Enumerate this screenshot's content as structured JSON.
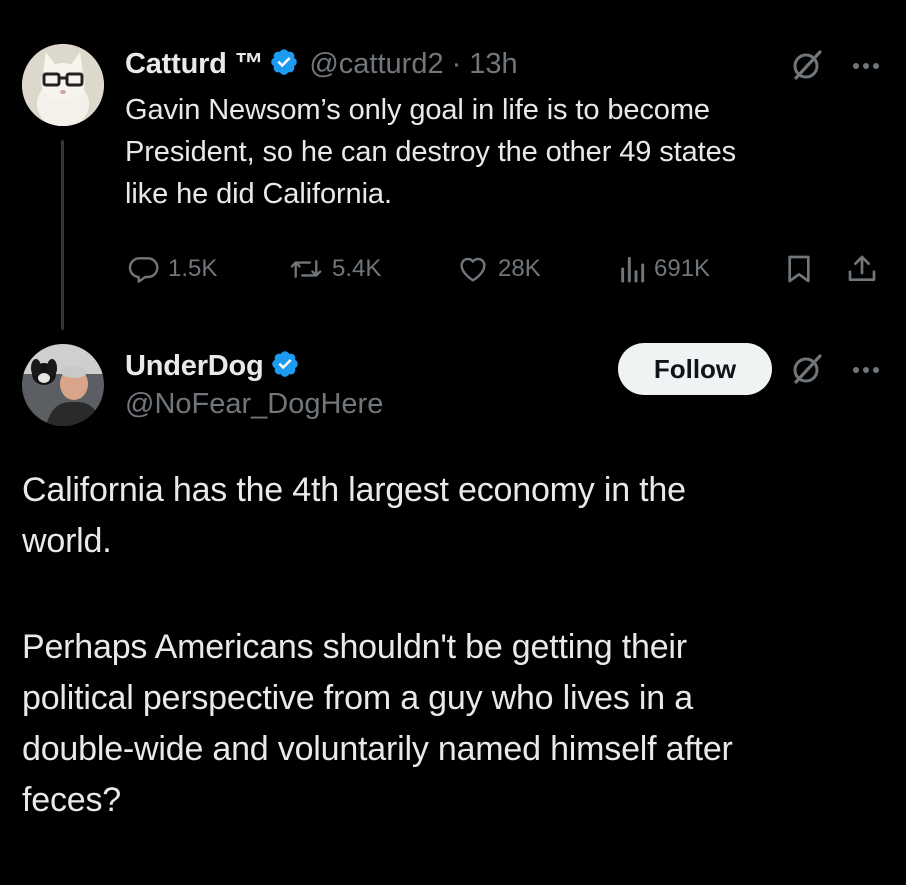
{
  "tweet": {
    "author_name": "Catturd ™",
    "handle": "@catturd2",
    "separator": "·",
    "time": "13h",
    "text_lines": [
      "Gavin Newsom’s only goal in life is to become",
      "President, so he can destroy the other 49 states",
      "like he did California."
    ],
    "actions": {
      "replies": "1.5K",
      "reposts": "5.4K",
      "likes": "28K",
      "views": "691K"
    }
  },
  "reply": {
    "author_name": "UnderDog",
    "handle": "@NoFear_DogHere",
    "follow_label": "Follow",
    "paragraphs": [
      [
        "California has the 4th largest economy in the",
        "world."
      ],
      [
        "Perhaps Americans shouldn't be getting their",
        "political perspective from a guy who lives in a",
        "double-wide and voluntarily named himself after",
        "feces?"
      ]
    ]
  },
  "icons": {
    "verified": "verified-badge-icon",
    "grok": "grok-icon",
    "more": "more-icon",
    "reply": "reply-icon",
    "repost": "repost-icon",
    "like": "like-icon",
    "views": "views-icon",
    "bookmark": "bookmark-icon",
    "share": "share-icon"
  },
  "colors": {
    "background": "#000000",
    "text": "#e7e9ea",
    "muted": "#71767b",
    "verified": "#1d9bf0",
    "follow_bg": "#eff3f4"
  }
}
